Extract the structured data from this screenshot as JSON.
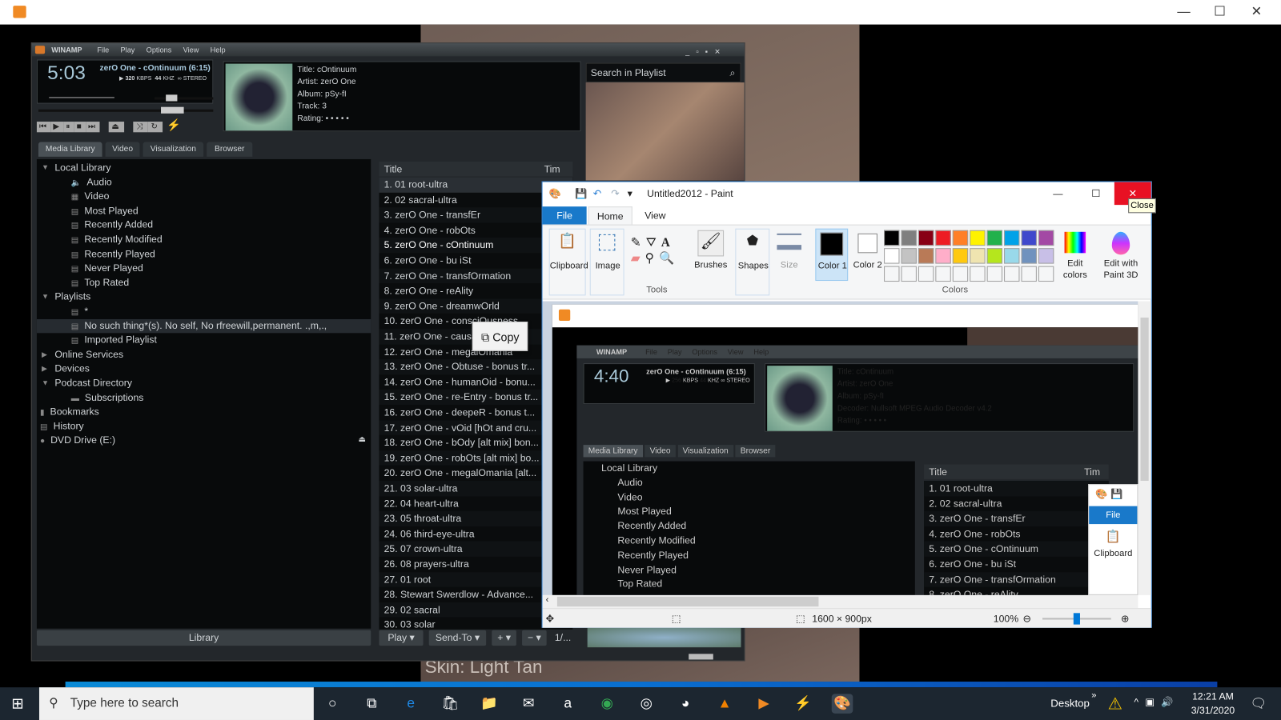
{
  "desktop": {
    "skin_caption": "Skin: Light Tan"
  },
  "outer_window": {
    "controls": {
      "minimize": "—",
      "maximize": "☐",
      "close": "✕"
    }
  },
  "winamp": {
    "title": "WINAMP",
    "menu": [
      "File",
      "Play",
      "Options",
      "View",
      "Help"
    ],
    "time": "5:03",
    "track_display": "zerO One - cOntinuum (6:15)",
    "bitrate": "320",
    "kbps": "KBPS",
    "khz": "44",
    "khz_label": "KHZ",
    "stereo": "STEREO",
    "volume_pct": 40,
    "seek_pct": 76,
    "info": {
      "title": "Title: cOntinuum",
      "artist": "Artist: zerO One",
      "album": "Album: pSy-fI",
      "track": "Track: 3",
      "rating": "Rating: • • • • •"
    },
    "search_placeholder": "Search in Playlist",
    "tabs": [
      "Media Library",
      "Video",
      "Visualization",
      "Browser"
    ],
    "tree": [
      {
        "label": "Local Library",
        "level": 0,
        "arrow": "▼"
      },
      {
        "label": "Audio",
        "level": 1,
        "icon": "🔈"
      },
      {
        "label": "Video",
        "level": 1,
        "icon": "▦"
      },
      {
        "label": "Most Played",
        "level": 1,
        "icon": "▤"
      },
      {
        "label": "Recently Added",
        "level": 1,
        "icon": "▤"
      },
      {
        "label": "Recently Modified",
        "level": 1,
        "icon": "▤"
      },
      {
        "label": "Recently Played",
        "level": 1,
        "icon": "▤"
      },
      {
        "label": "Never Played",
        "level": 1,
        "icon": "▤"
      },
      {
        "label": "Top Rated",
        "level": 1,
        "icon": "▤"
      },
      {
        "label": "Playlists",
        "level": 0,
        "arrow": "▼"
      },
      {
        "label": "*",
        "level": 1,
        "icon": "▤"
      },
      {
        "label": "No such thing*(s). No self, No rfreewill,permanent. .,m,.,",
        "level": 1,
        "icon": "▤",
        "selected": true
      },
      {
        "label": "Imported Playlist",
        "level": 1,
        "icon": "▤"
      },
      {
        "label": "Online Services",
        "level": 0,
        "arrow": "▶"
      },
      {
        "label": "Devices",
        "level": 0,
        "arrow": "▶"
      },
      {
        "label": "Podcast Directory",
        "level": 0,
        "arrow": "▼"
      },
      {
        "label": "Subscriptions",
        "level": 1,
        "icon": "▬"
      },
      {
        "label": "Bookmarks",
        "level": -1,
        "icon": "▮"
      },
      {
        "label": "History",
        "level": -1,
        "icon": "▤"
      },
      {
        "label": "DVD Drive (E:)",
        "level": -1,
        "icon": "●"
      }
    ],
    "library_button": "Library",
    "playlist_header": {
      "title": "Title",
      "time": "Tim"
    },
    "playlist": [
      "1. 01 root-ultra",
      "2. 02 sacral-ultra",
      "3. zerO One - transfEr",
      "4. zerO One - robOts",
      "5. zerO One - cOntinuum",
      "6. zerO One - bu iSt",
      "7. zerO One - transfOrmation",
      "8. zerO One - reAlity",
      "9. zerO One - dreamwOrld",
      "10. zerO One - consciOusness",
      "11. zerO One - causa",
      "12. zerO One - megalOmania",
      "13. zerO One - Obtuse - bonus tr...",
      "14. zerO One - humanOid - bonu...",
      "15. zerO One - re-Entry - bonus tr...",
      "16. zerO One - deepeR - bonus t...",
      "17. zerO One - vOid [hOt and cru...",
      "18. zerO One - bOdy [alt mix] bon...",
      "19. zerO One - robOts [alt mix] bo...",
      "20. zerO One - megalOmania [alt...",
      "21. 03 solar-ultra",
      "22. 04 heart-ultra",
      "23. 05 throat-ultra",
      "24. 06 third-eye-ultra",
      "25. 07 crown-ultra",
      "26. 08 prayers-ultra",
      "27. 01 root",
      "28. Stewart Swerdlow - Advance...",
      "29. 02 sacral",
      "30. 03 solar"
    ],
    "playlist_buttons": {
      "play": "Play",
      "send_to": "Send-To",
      "add": "+",
      "remove": "−",
      "count": "1/..."
    }
  },
  "context_menu": {
    "copy": "Copy"
  },
  "paint": {
    "title": "Untitled2012 - Paint",
    "tooltip": "Close",
    "tabs": [
      "File",
      "Home",
      "View"
    ],
    "groups": {
      "clipboard": "Clipboard",
      "image": "Image",
      "tools": "Tools",
      "brushes": "Brushes",
      "shapes": "Shapes",
      "size": "Size",
      "color1": "Color 1",
      "color2": "Color 2",
      "colors": "Colors",
      "edit_colors": "Edit colors",
      "paint3d": "Edit with Paint 3D"
    },
    "palette": [
      "#000000",
      "#7f7f7f",
      "#880015",
      "#ed1c24",
      "#ff7f27",
      "#fff200",
      "#22b14c",
      "#00a2e8",
      "#3f48cc",
      "#a349a4",
      "#ffffff",
      "#c3c3c3",
      "#b97a57",
      "#ffaec9",
      "#ffc90e",
      "#efe4b0",
      "#b5e61d",
      "#99d9ea",
      "#7092be",
      "#c8bfe7"
    ],
    "status": {
      "size": "1600 × 900px",
      "zoom": "100%",
      "zoom_pct": 50
    }
  },
  "inner_winamp": {
    "title": "WINAMP",
    "menu": [
      "File",
      "Play",
      "Options",
      "View",
      "Help"
    ],
    "time": "4:40",
    "track_display": "zerO One - cOntinuum (6:15)",
    "bitrate": "256",
    "khz": "44",
    "info": {
      "title": "Title: cOntinuum",
      "artist": "Artist: zerO One",
      "album": "Album: pSy-fI",
      "decoder": "Decoder: Nullsoft MPEG Audio Decoder v4.2",
      "rating": "Rating: • • • • •"
    },
    "tabs": [
      "Media Library",
      "Video",
      "Visualization",
      "Browser"
    ],
    "tree": [
      "Local Library",
      "Audio",
      "Video",
      "Most Played",
      "Recently Added",
      "Recently Modified",
      "Recently Played",
      "Never Played",
      "Top Rated"
    ],
    "playlist_header": {
      "title": "Title",
      "time": "Tim"
    },
    "playlist": [
      "1. 01 root-ultra",
      "2. 02 sacral-ultra",
      "3. zerO One - transfEr",
      "4. zerO One - robOts",
      "5. zerO One - cOntinuum",
      "6. zerO One - bu iSt",
      "7. zerO One - transfOrmation",
      "8. zerO One - reAlity"
    ],
    "mini_paint": {
      "file": "File",
      "clipboard": "Clipboard"
    }
  },
  "taskbar": {
    "search_placeholder": "Type here to search",
    "desktop": "Desktop",
    "time": "12:21 AM",
    "date": "3/31/2020",
    "apps": [
      "cortana",
      "task-view",
      "edge",
      "store",
      "file-explorer",
      "mail",
      "amazon",
      "tripadvisor",
      "camera",
      "colorful",
      "vlc",
      "winamp-app",
      "winamp-lightning",
      "paint"
    ]
  }
}
